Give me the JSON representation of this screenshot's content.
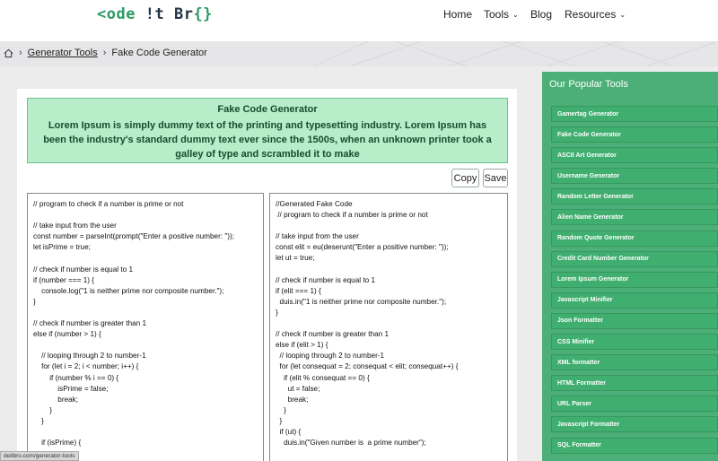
{
  "header": {
    "logo_prefix": "<",
    "logo_text_green": "ode",
    "logo_bang": "!t",
    "logo_br": "Br",
    "logo_suffix": "{}",
    "nav": [
      {
        "label": "Home"
      },
      {
        "label": "Tools",
        "has_dropdown": true
      },
      {
        "label": "Blog"
      },
      {
        "label": "Resources",
        "has_dropdown": true
      }
    ]
  },
  "breadcrumb": {
    "home_icon": "home-icon",
    "link": "Generator Tools",
    "current": "Fake Code Generator"
  },
  "description": {
    "title": "Fake Code Generator",
    "text": "Lorem Ipsum is simply dummy text of the printing and typesetting industry. Lorem Ipsum has been the industry's standard dummy text ever since the 1500s, when an unknown printer took a galley of type and scrambled it to make"
  },
  "buttons": {
    "copy": "Copy",
    "save": "Save"
  },
  "input_code": "// program to check if a number is prime or not\n\n// take input from the user\nconst number = parseInt(prompt(\"Enter a positive number: \"));\nlet isPrime = true;\n\n// check if number is equal to 1\nif (number === 1) {\n    console.log(\"1 is neither prime nor composite number.\");\n}\n\n// check if number is greater than 1\nelse if (number > 1) {\n\n    // looping through 2 to number-1\n    for (let i = 2; i < number; i++) {\n        if (number % i == 0) {\n            isPrime = false;\n            break;\n        }\n    }\n\n    if (isPrime) {",
  "output_code": "//Generated Fake Code\n // program to check if a number is prime or not\n\n// take input from the user\nconst elit = eu(deserunt(\"Enter a positive number: \"));\nlet ut = true;\n\n// check if number is equal to 1\nif (elit === 1) {\n  duis.in(\"1 is neither prime nor composite number.\");\n}\n\n// check if number is greater than 1\nelse if (elit > 1) {\n  // looping through 2 to number-1\n  for (let consequat = 2; consequat < elit; consequat++) {\n    if (elit % consequat == 0) {\n      ut = false;\n      break;\n    }\n  }\n  if (ut) {\n    duis.in(\"Given number is  a prime number\");",
  "sidebar": {
    "title": "Our Popular Tools",
    "items": [
      "Gamertag Generator",
      "Fake Code Generator",
      "ASCII Art Generator",
      "Username Generator",
      "Random Letter Generator",
      "Alien Name Generator",
      "Random Quote Generator",
      "Credit Card Number Generator",
      "Lorem Ipsum Generator",
      "Javascript Minifier",
      "Json Formatter",
      "CSS Minifier",
      "XML formatter",
      "HTML Formatter",
      "URL Parser",
      "Javascript Formatter",
      "SQL Formatter"
    ]
  },
  "status_url": "deitbro.com/generator-tools",
  "colors": {
    "brand_green": "#2d9a63",
    "sidebar_green": "#4caf78",
    "desc_bg": "#b7edc9"
  }
}
